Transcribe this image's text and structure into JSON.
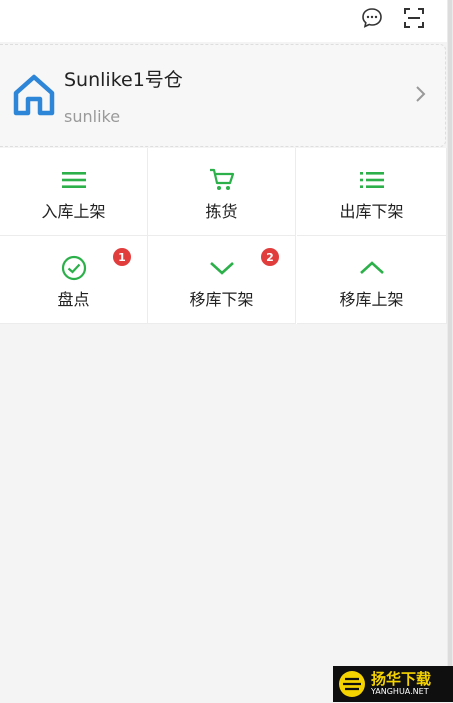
{
  "header": {
    "icons": [
      "chat-icon",
      "scan-icon"
    ]
  },
  "warehouse": {
    "title": "Sunlike1号仓",
    "subtitle": "sunlike",
    "icon": "house-icon"
  },
  "actions": [
    {
      "label": "入库上架",
      "icon": "menu-lines-icon",
      "badge": null
    },
    {
      "label": "拣货",
      "icon": "cart-icon",
      "badge": null
    },
    {
      "label": "出库下架",
      "icon": "list-icon",
      "badge": null
    },
    {
      "label": "盘点",
      "icon": "check-circle-icon",
      "badge": "1"
    },
    {
      "label": "移库下架",
      "icon": "chevron-down-icon",
      "badge": "2"
    },
    {
      "label": "移库上架",
      "icon": "chevron-up-icon",
      "badge": null
    }
  ],
  "colors": {
    "accent_green": "#2bb04a",
    "brand_blue": "#2e86d8",
    "badge_red": "#e23d3d"
  },
  "watermark": {
    "cn": "扬华下载",
    "en": "YANGHUA.NET"
  }
}
